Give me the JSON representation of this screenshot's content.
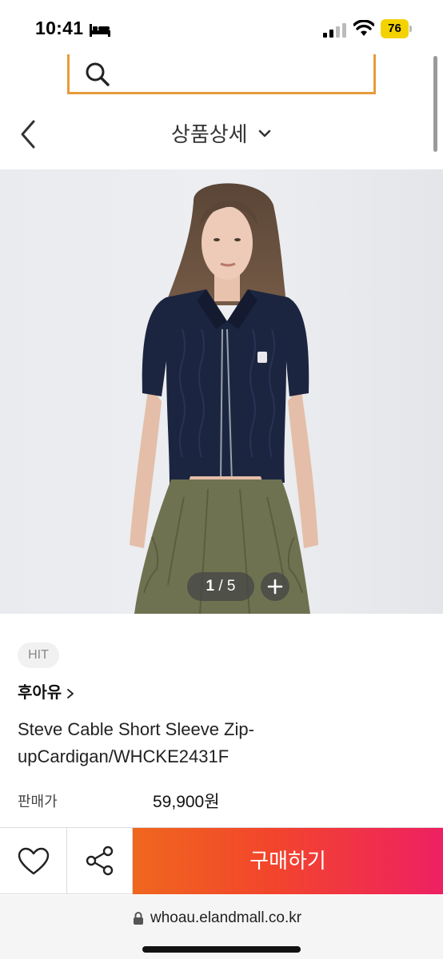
{
  "status_bar": {
    "time": "10:41",
    "battery": "76",
    "icons": [
      "bed-icon",
      "signal-icon",
      "wifi-icon",
      "battery-icon"
    ]
  },
  "search": {
    "value": "",
    "placeholder": ""
  },
  "header": {
    "title": "상품상세",
    "icons": [
      "back-chevron-icon",
      "chevron-down-icon"
    ]
  },
  "gallery": {
    "current": "1",
    "separator": " / ",
    "total": "5",
    "image": "product-photo: model wearing navy cable knit short sleeve zip-up cardigan with khaki cargo skirt"
  },
  "product": {
    "badge": "HIT",
    "brand": "후아유",
    "name": "Steve Cable Short Sleeve Zip-upCardigan/WHCKE2431F",
    "price_label": "판매가",
    "price": "59,900원"
  },
  "actions": {
    "buy_label": "구매하기",
    "icons": [
      "heart-icon",
      "share-icon"
    ]
  },
  "browser": {
    "url": "whoau.elandmall.co.kr"
  },
  "colors": {
    "search_border": "#e89a3c",
    "buy_gradient_start": "#f0671e",
    "buy_gradient_end": "#ee2062",
    "battery": "#f2d200",
    "cardigan": "#1c2540",
    "skirt": "#6e7250"
  }
}
